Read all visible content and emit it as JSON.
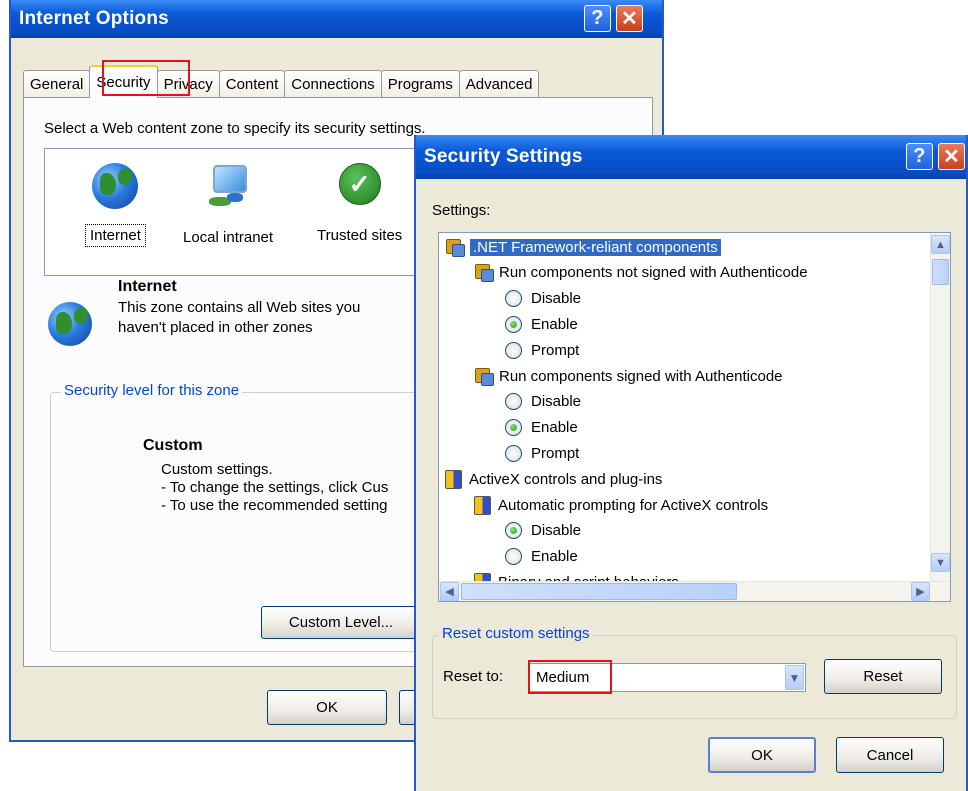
{
  "internet_options": {
    "title": "Internet Options",
    "tabs": [
      "General",
      "Security",
      "Privacy",
      "Content",
      "Connections",
      "Programs",
      "Advanced"
    ],
    "active_tab": "Security",
    "zone_prompt": "Select a Web content zone to specify its security settings.",
    "zones": [
      {
        "label": "Internet",
        "icon": "globe-icon"
      },
      {
        "label": "Local intranet",
        "icon": "computer-icon"
      },
      {
        "label": "Trusted sites",
        "icon": "checkmark-icon"
      }
    ],
    "selected_zone": {
      "name": "Internet",
      "description_line1": "This zone contains all Web sites you",
      "description_line2": "haven't placed in other zones"
    },
    "security_level": {
      "legend": "Security level for this zone",
      "level_name": "Custom",
      "line1": "Custom settings.",
      "line2": "- To change the settings, click Cus",
      "line3": "- To use the recommended setting"
    },
    "custom_level_button": "Custom Level...",
    "ok_button": "OK"
  },
  "security_settings": {
    "title": "Security Settings",
    "settings_label": "Settings:",
    "tree": [
      {
        "kind": "gear",
        "indent": 0,
        "label": ".NET Framework-reliant components",
        "selected": true
      },
      {
        "kind": "gear",
        "indent": 1,
        "label": "Run components not signed with Authenticode"
      },
      {
        "kind": "radio",
        "indent": 2,
        "label": "Disable",
        "checked": false
      },
      {
        "kind": "radio",
        "indent": 2,
        "label": "Enable",
        "checked": true
      },
      {
        "kind": "radio",
        "indent": 2,
        "label": "Prompt",
        "checked": false
      },
      {
        "kind": "gear",
        "indent": 1,
        "label": "Run components signed with Authenticode"
      },
      {
        "kind": "radio",
        "indent": 2,
        "label": "Disable",
        "checked": false
      },
      {
        "kind": "radio",
        "indent": 2,
        "label": "Enable",
        "checked": true
      },
      {
        "kind": "radio",
        "indent": 2,
        "label": "Prompt",
        "checked": false
      },
      {
        "kind": "shield",
        "indent": 0,
        "label": "ActiveX controls and plug-ins"
      },
      {
        "kind": "shield",
        "indent": 1,
        "label": "Automatic prompting for ActiveX controls"
      },
      {
        "kind": "radio",
        "indent": 2,
        "label": "Disable",
        "checked": true
      },
      {
        "kind": "radio",
        "indent": 2,
        "label": "Enable",
        "checked": false
      },
      {
        "kind": "shield",
        "indent": 1,
        "label": "Binary and script behaviors"
      }
    ],
    "reset_group": {
      "legend": "Reset custom settings",
      "reset_to_label": "Reset to:",
      "reset_to_value": "Medium",
      "reset_button": "Reset"
    },
    "ok_button": "OK",
    "cancel_button": "Cancel"
  },
  "colors": {
    "highlight_box": "#e2141b",
    "titlebar_blue": "#0b5ad8",
    "selection_blue": "#316ac5",
    "legend_blue": "#0046d5"
  }
}
